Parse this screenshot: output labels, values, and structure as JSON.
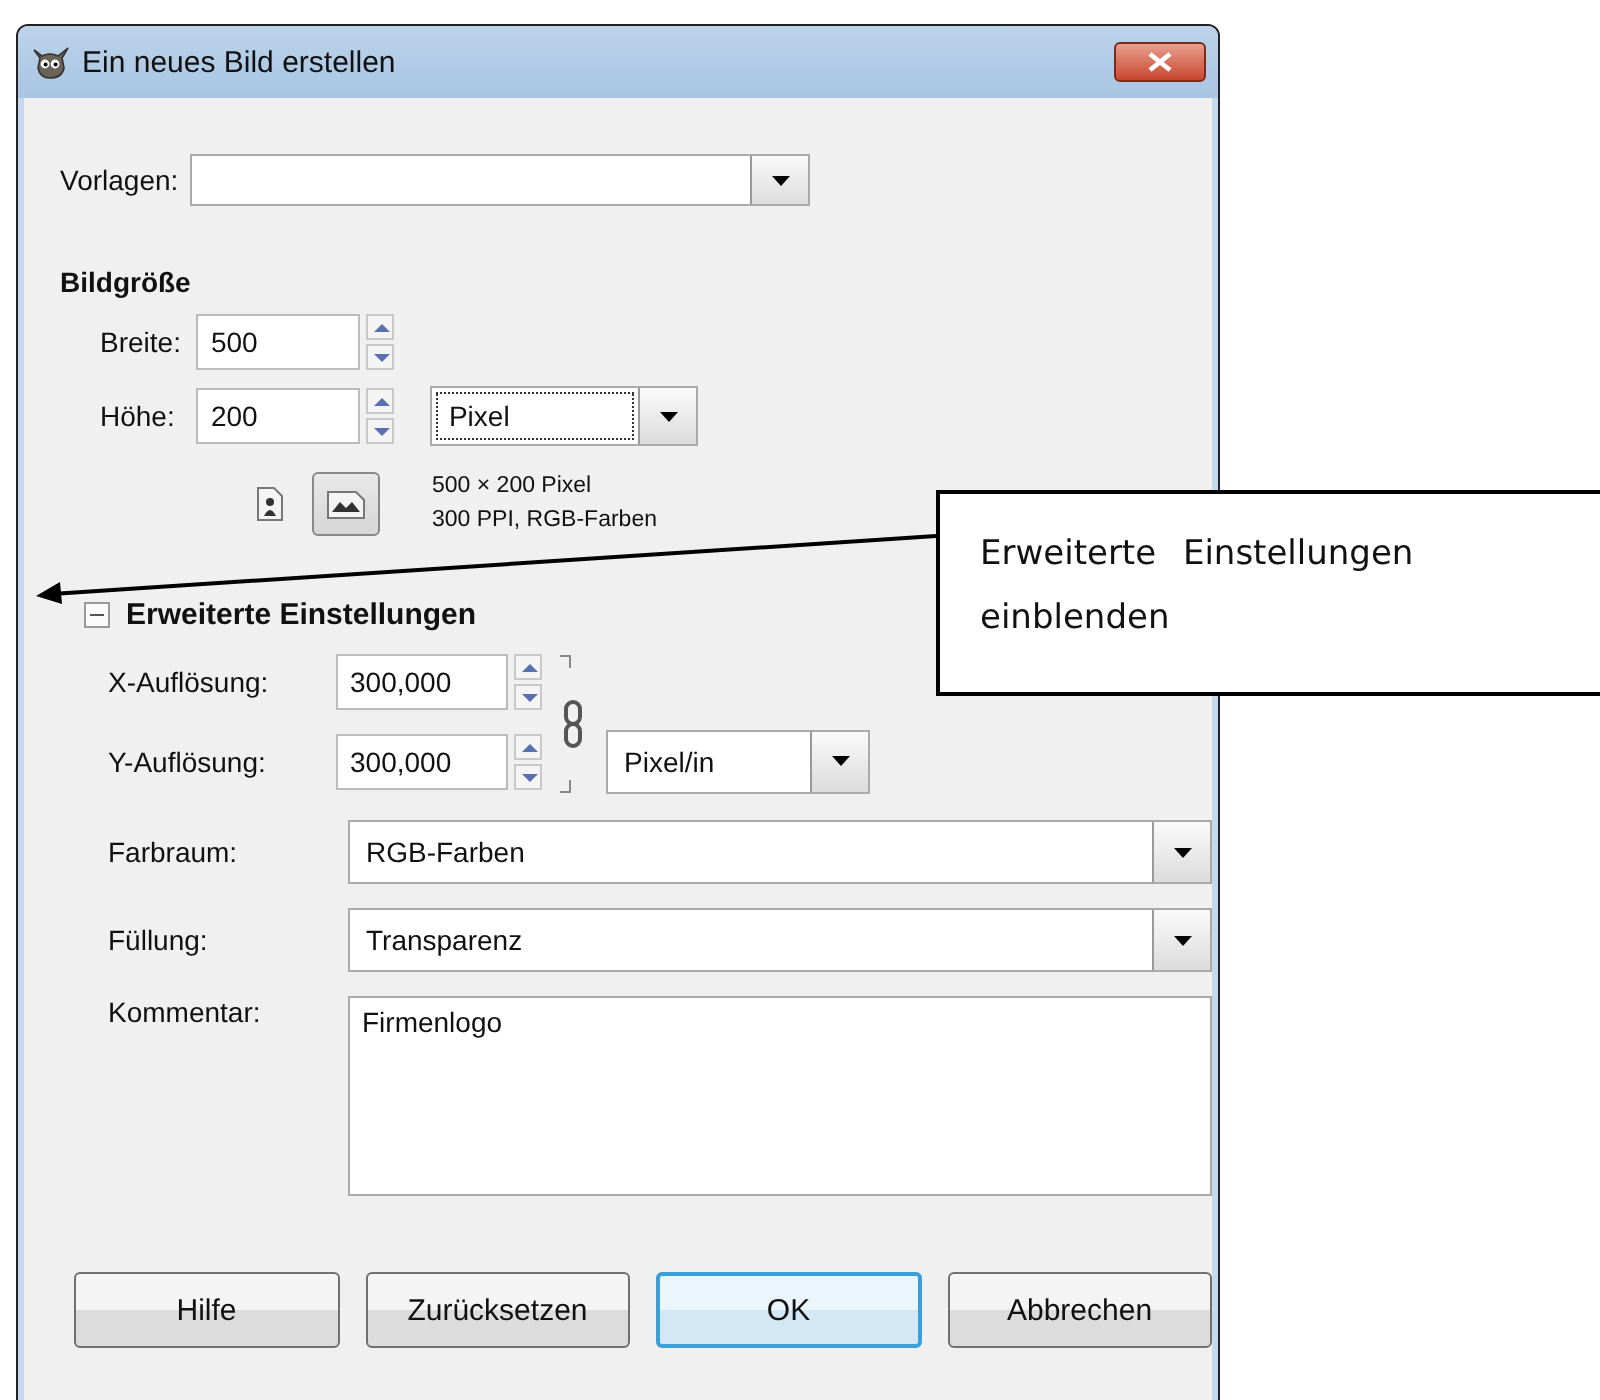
{
  "window": {
    "title": "Ein neues Bild erstellen"
  },
  "template": {
    "label": "Vorlagen:"
  },
  "image_size": {
    "heading": "Bildgröße",
    "width": {
      "label": "Breite:",
      "value": "500"
    },
    "height": {
      "label": "Höhe:",
      "value": "200"
    },
    "unit": "Pixel",
    "orientation": [
      {
        "kind": "portrait",
        "selected": false
      },
      {
        "kind": "landscape",
        "selected": true
      }
    ],
    "info": [
      "500 × 200 Pixel",
      "300 PPI, RGB-Farben"
    ]
  },
  "advanced": {
    "label": "Erweiterte Einstellungen",
    "expanded": true,
    "x_resolution": {
      "label": "X-Auflösung:",
      "value": "300,000"
    },
    "y_resolution": {
      "label": "Y-Auflösung:",
      "value": "300,000"
    },
    "resolution_unit": "Pixel/in",
    "color_space": {
      "label": "Farbraum:",
      "value": "RGB-Farben"
    },
    "fill": {
      "label": "Füllung:",
      "value": "Transparenz"
    },
    "comment": {
      "label": "Kommentar:",
      "value": "Firmenlogo"
    }
  },
  "buttons": [
    {
      "label": "Hilfe",
      "default": false
    },
    {
      "label": "Zurücksetzen",
      "default": false
    },
    {
      "label": "OK",
      "default": true
    },
    {
      "label": "Abbrechen",
      "default": false
    }
  ],
  "callout": {
    "text": "Erweiterte Einstellungen einblenden"
  }
}
